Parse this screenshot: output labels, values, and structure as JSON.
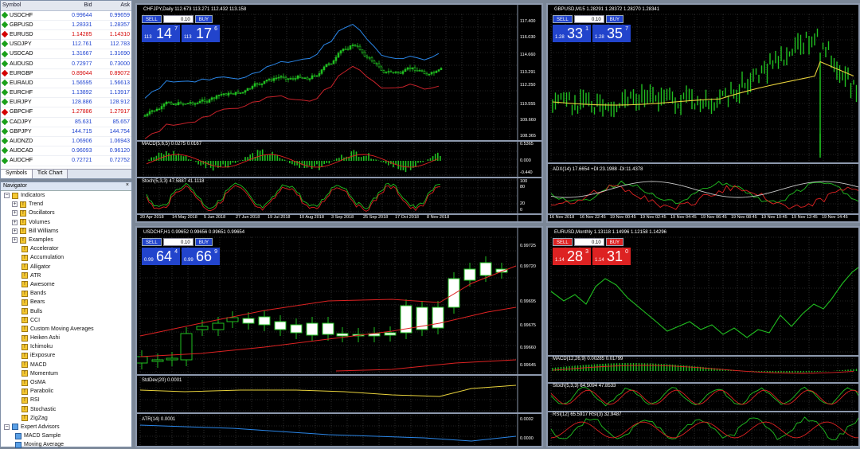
{
  "market_watch": {
    "headers": {
      "symbol": "Symbol",
      "bid": "Bid",
      "ask": "Ask"
    },
    "rows": [
      {
        "symbol": "USDCHF",
        "bid": "0.99644",
        "ask": "0.99659",
        "color": "blue"
      },
      {
        "symbol": "GBPUSD",
        "bid": "1.28331",
        "ask": "1.28357",
        "color": "blue"
      },
      {
        "symbol": "EURUSD",
        "bid": "1.14285",
        "ask": "1.14310",
        "color": "red"
      },
      {
        "symbol": "USDJPY",
        "bid": "112.761",
        "ask": "112.783",
        "color": "blue"
      },
      {
        "symbol": "USDCAD",
        "bid": "1.31667",
        "ask": "1.31690",
        "color": "blue"
      },
      {
        "symbol": "AUDUSD",
        "bid": "0.72977",
        "ask": "0.73000",
        "color": "blue"
      },
      {
        "symbol": "EURGBP",
        "bid": "0.89044",
        "ask": "0.89072",
        "color": "red"
      },
      {
        "symbol": "EURAUD",
        "bid": "1.56595",
        "ask": "1.56613",
        "color": "blue"
      },
      {
        "symbol": "EURCHF",
        "bid": "1.13892",
        "ask": "1.13917",
        "color": "blue"
      },
      {
        "symbol": "EURJPY",
        "bid": "128.886",
        "ask": "128.912",
        "color": "blue"
      },
      {
        "symbol": "GBPCHF",
        "bid": "1.27886",
        "ask": "1.27917",
        "color": "red"
      },
      {
        "symbol": "CADJPY",
        "bid": "85.631",
        "ask": "85.657",
        "color": "blue"
      },
      {
        "symbol": "GBPJPY",
        "bid": "144.715",
        "ask": "144.754",
        "color": "blue"
      },
      {
        "symbol": "AUDNZD",
        "bid": "1.06906",
        "ask": "1.06943",
        "color": "blue"
      },
      {
        "symbol": "AUDCAD",
        "bid": "0.96093",
        "ask": "0.96120",
        "color": "blue"
      },
      {
        "symbol": "AUDCHF",
        "bid": "0.72721",
        "ask": "0.72752",
        "color": "blue"
      }
    ],
    "tabs": [
      "Symbols",
      "Tick Chart"
    ]
  },
  "navigator": {
    "title": "Navigator",
    "close": "×",
    "indicators_label": "Indicators",
    "folders": [
      "Trend",
      "Oscillators",
      "Volumes",
      "Bill Williams",
      "Examples"
    ],
    "items": [
      "Accelerator",
      "Accumulation",
      "Alligator",
      "ATR",
      "Awesome",
      "Bands",
      "Bears",
      "Bulls",
      "CCI",
      "Custom Moving Averages",
      "Heiken Ashi",
      "Ichimoku",
      "iExposure",
      "MACD",
      "Momentum",
      "OsMA",
      "Parabolic",
      "RSI",
      "Stochastic",
      "ZigZag"
    ],
    "expert_label": "Expert Advisors",
    "experts": [
      "MACD Sample",
      "Moving Average"
    ]
  },
  "charts": {
    "c1": {
      "title": "CHFJPY,Daily  112.673 113.271 112.432 113.158",
      "trade": {
        "sell": "SELL",
        "lot": "0.10",
        "buy": "BUY",
        "sell_small": "113",
        "sell_big": "14",
        "sell_exp": "7",
        "buy_small": "113",
        "buy_big": "17",
        "buy_exp": "6"
      },
      "macd_label": "MACD(5,6,5) 0.0275 0.0167",
      "stoch_label": "Stoch(5,3,3) 47.5887 41.1118",
      "price_ticks": [
        "117.400",
        "116.030",
        "114.660",
        "113.291",
        "112.250",
        "110.555",
        "109.660",
        "108.365"
      ],
      "macd_ticks": [
        "0.5365",
        "0.000",
        "-0.440"
      ],
      "stoch_ticks": [
        "100",
        "80",
        "20",
        "0"
      ],
      "dates": [
        "20 Apr 2018",
        "14 May 2018",
        "5 Jun 2018",
        "27 Jun 2018",
        "19 Jul 2018",
        "10 Aug 2018",
        "3 Sep 2018",
        "25 Sep 2018",
        "17 Oct 2018",
        "8 Nov 2018"
      ]
    },
    "c2": {
      "title": "GBPUSD,M15  1.28291 1.28372 1.28270 1.28341",
      "trade": {
        "sell": "SELL",
        "lot": "0.10",
        "buy": "BUY",
        "sell_small": "1.28",
        "sell_big": "33",
        "sell_exp": "1",
        "buy_small": "1.28",
        "buy_big": "35",
        "buy_exp": "7"
      },
      "adx_label": "ADX(14) 17.6654 +DI:23.1988 -DI:11.4378",
      "dates": [
        "16 Nov 2018",
        "16 Nov 22:45",
        "19 Nov 00:45",
        "19 Nov 02:45",
        "19 Nov 04:45",
        "19 Nov 06:45",
        "19 Nov 08:45",
        "19 Nov 10:45",
        "19 Nov 12:45",
        "19 Nov 14:45"
      ]
    },
    "c3": {
      "title": "USDCHF,H1  0.99652 0.99656 0.99651 0.99654",
      "trade": {
        "sell": "SELL",
        "lot": "0.10",
        "buy": "BUY",
        "sell_small": "0.99",
        "sell_big": "64",
        "sell_exp": "4",
        "buy_small": "0.99",
        "buy_big": "66",
        "buy_exp": "9"
      },
      "stddev_label": "StdDev(20) 0.0001",
      "atr_label": "ATR(14) 0.0001",
      "price_ticks": [
        "0.99725",
        "0.99720",
        "0.99695",
        "0.99675",
        "0.99660",
        "0.99645"
      ],
      "atr_ticks": [
        "0.0002",
        "0.0000"
      ]
    },
    "c4": {
      "title": "EURUSD,Monthly  1.13118 1.14996 1.12158 1.14296",
      "trade": {
        "sell": "SELL",
        "lot": "0.10",
        "buy": "BUY",
        "sell_small": "1.14",
        "sell_big": "28",
        "sell_exp": "3",
        "buy_small": "1.14",
        "buy_big": "31",
        "buy_exp": "0"
      },
      "macd_label": "MACD(12,26,9) 0.00285 0.01799",
      "stoch_label": "Stoch(5,3,3) 64.5094 47.8533",
      "rsi_label": "RSI(12) 65.5917  RSI(3) 32.9487"
    }
  }
}
